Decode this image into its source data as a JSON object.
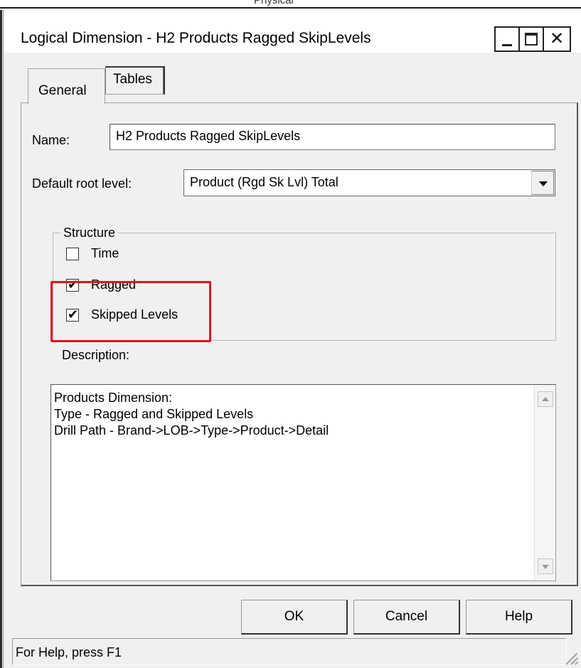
{
  "window": {
    "title": "Logical Dimension - H2 Products Ragged SkipLevels",
    "background_title_fragment": "Physical"
  },
  "tabs": [
    {
      "label": "General",
      "active": true
    },
    {
      "label": "Tables",
      "active": false
    }
  ],
  "form": {
    "name_label": "Name:",
    "name_value": "H2 Products Ragged SkipLevels",
    "root_label": "Default root level:",
    "root_value": "Product (Rgd Sk Lvl) Total",
    "structure_legend": "Structure",
    "checkboxes": [
      {
        "label": "Time",
        "checked": false
      },
      {
        "label": "Ragged",
        "checked": true
      },
      {
        "label": "Skipped Levels",
        "checked": true
      }
    ],
    "description_label": "Description:",
    "description_lines": [
      "Products Dimension:",
      "Type - Ragged and Skipped Levels",
      "Drill Path - Brand->LOB->Type->Product->Detail"
    ]
  },
  "buttons": {
    "ok": "OK",
    "cancel": "Cancel",
    "help": "Help"
  },
  "status": {
    "text": "For Help, press F1"
  },
  "colors": {
    "highlight": "#e0141e",
    "dialog_bg": "#f0f0f0"
  },
  "icons": {
    "check": "✔",
    "close": "✕"
  }
}
